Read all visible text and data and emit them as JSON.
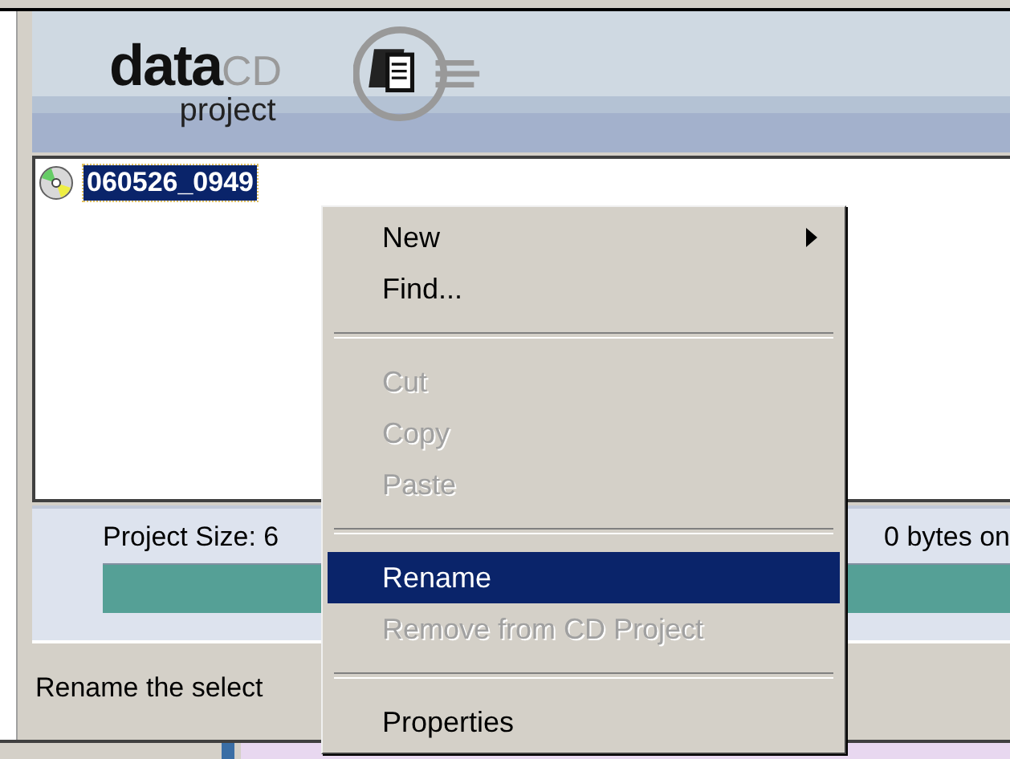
{
  "header": {
    "logo": {
      "word_1": "data",
      "word_2": "CD",
      "word_3": "project"
    }
  },
  "tree": {
    "items": [
      {
        "label": "060526_0949",
        "selected": true
      }
    ]
  },
  "project_size": {
    "label": "Project Size: 6",
    "text_2": "0 bytes on",
    "level": 1
  },
  "status_bar": {
    "text": "Rename the select"
  },
  "context_menu": {
    "items": [
      {
        "kind": "item",
        "label": "New",
        "submenu": true,
        "disabled": false,
        "selected": false
      },
      {
        "kind": "item",
        "label": "Find...",
        "submenu": false,
        "disabled": false,
        "selected": false
      },
      {
        "kind": "separator"
      },
      {
        "kind": "item",
        "label": "Cut",
        "submenu": false,
        "disabled": true,
        "selected": false
      },
      {
        "kind": "item",
        "label": "Copy",
        "submenu": false,
        "disabled": true,
        "selected": false
      },
      {
        "kind": "item",
        "label": "Paste",
        "submenu": false,
        "disabled": true,
        "selected": false
      },
      {
        "kind": "separator"
      },
      {
        "kind": "item",
        "label": "Rename",
        "submenu": false,
        "disabled": false,
        "selected": true
      },
      {
        "kind": "item",
        "label": "Remove from CD Project",
        "submenu": false,
        "disabled": true,
        "selected": false
      },
      {
        "kind": "separator"
      },
      {
        "kind": "item",
        "label": "Properties",
        "submenu": false,
        "disabled": false,
        "selected": false
      }
    ]
  }
}
